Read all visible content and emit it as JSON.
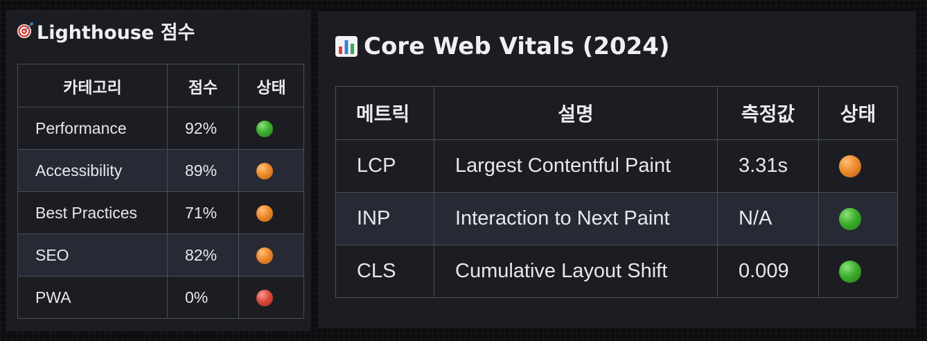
{
  "lighthouse": {
    "title": "Lighthouse 점수",
    "title_icon": "direct-hit-target-icon",
    "headers": [
      "카테고리",
      "점수",
      "상태"
    ],
    "rows": [
      {
        "category": "Performance",
        "score": "92%",
        "status": "green"
      },
      {
        "category": "Accessibility",
        "score": "89%",
        "status": "orange"
      },
      {
        "category": "Best Practices",
        "score": "71%",
        "status": "orange"
      },
      {
        "category": "SEO",
        "score": "82%",
        "status": "orange"
      },
      {
        "category": "PWA",
        "score": "0%",
        "status": "red"
      }
    ]
  },
  "core_web_vitals": {
    "title": "Core Web Vitals (2024)",
    "title_icon": "bar-chart-icon",
    "headers": [
      "메트릭",
      "설명",
      "측정값",
      "상태"
    ],
    "rows": [
      {
        "metric": "LCP",
        "description": "Largest Contentful Paint",
        "value": "3.31s",
        "status": "orange"
      },
      {
        "metric": "INP",
        "description": "Interaction to Next Paint",
        "value": "N/A",
        "status": "green"
      },
      {
        "metric": "CLS",
        "description": "Cumulative Layout Shift",
        "value": "0.009",
        "status": "green"
      }
    ]
  },
  "status_colors": {
    "green": "#3dae2e",
    "orange": "#ee8a2a",
    "red": "#db4a3c"
  },
  "theme": {
    "page_background": "#0c0d0f",
    "panel_background": "#1c1d22",
    "alt_row_background": "#272a34",
    "border": "#4b4e57",
    "text": "#e6e8ec"
  }
}
